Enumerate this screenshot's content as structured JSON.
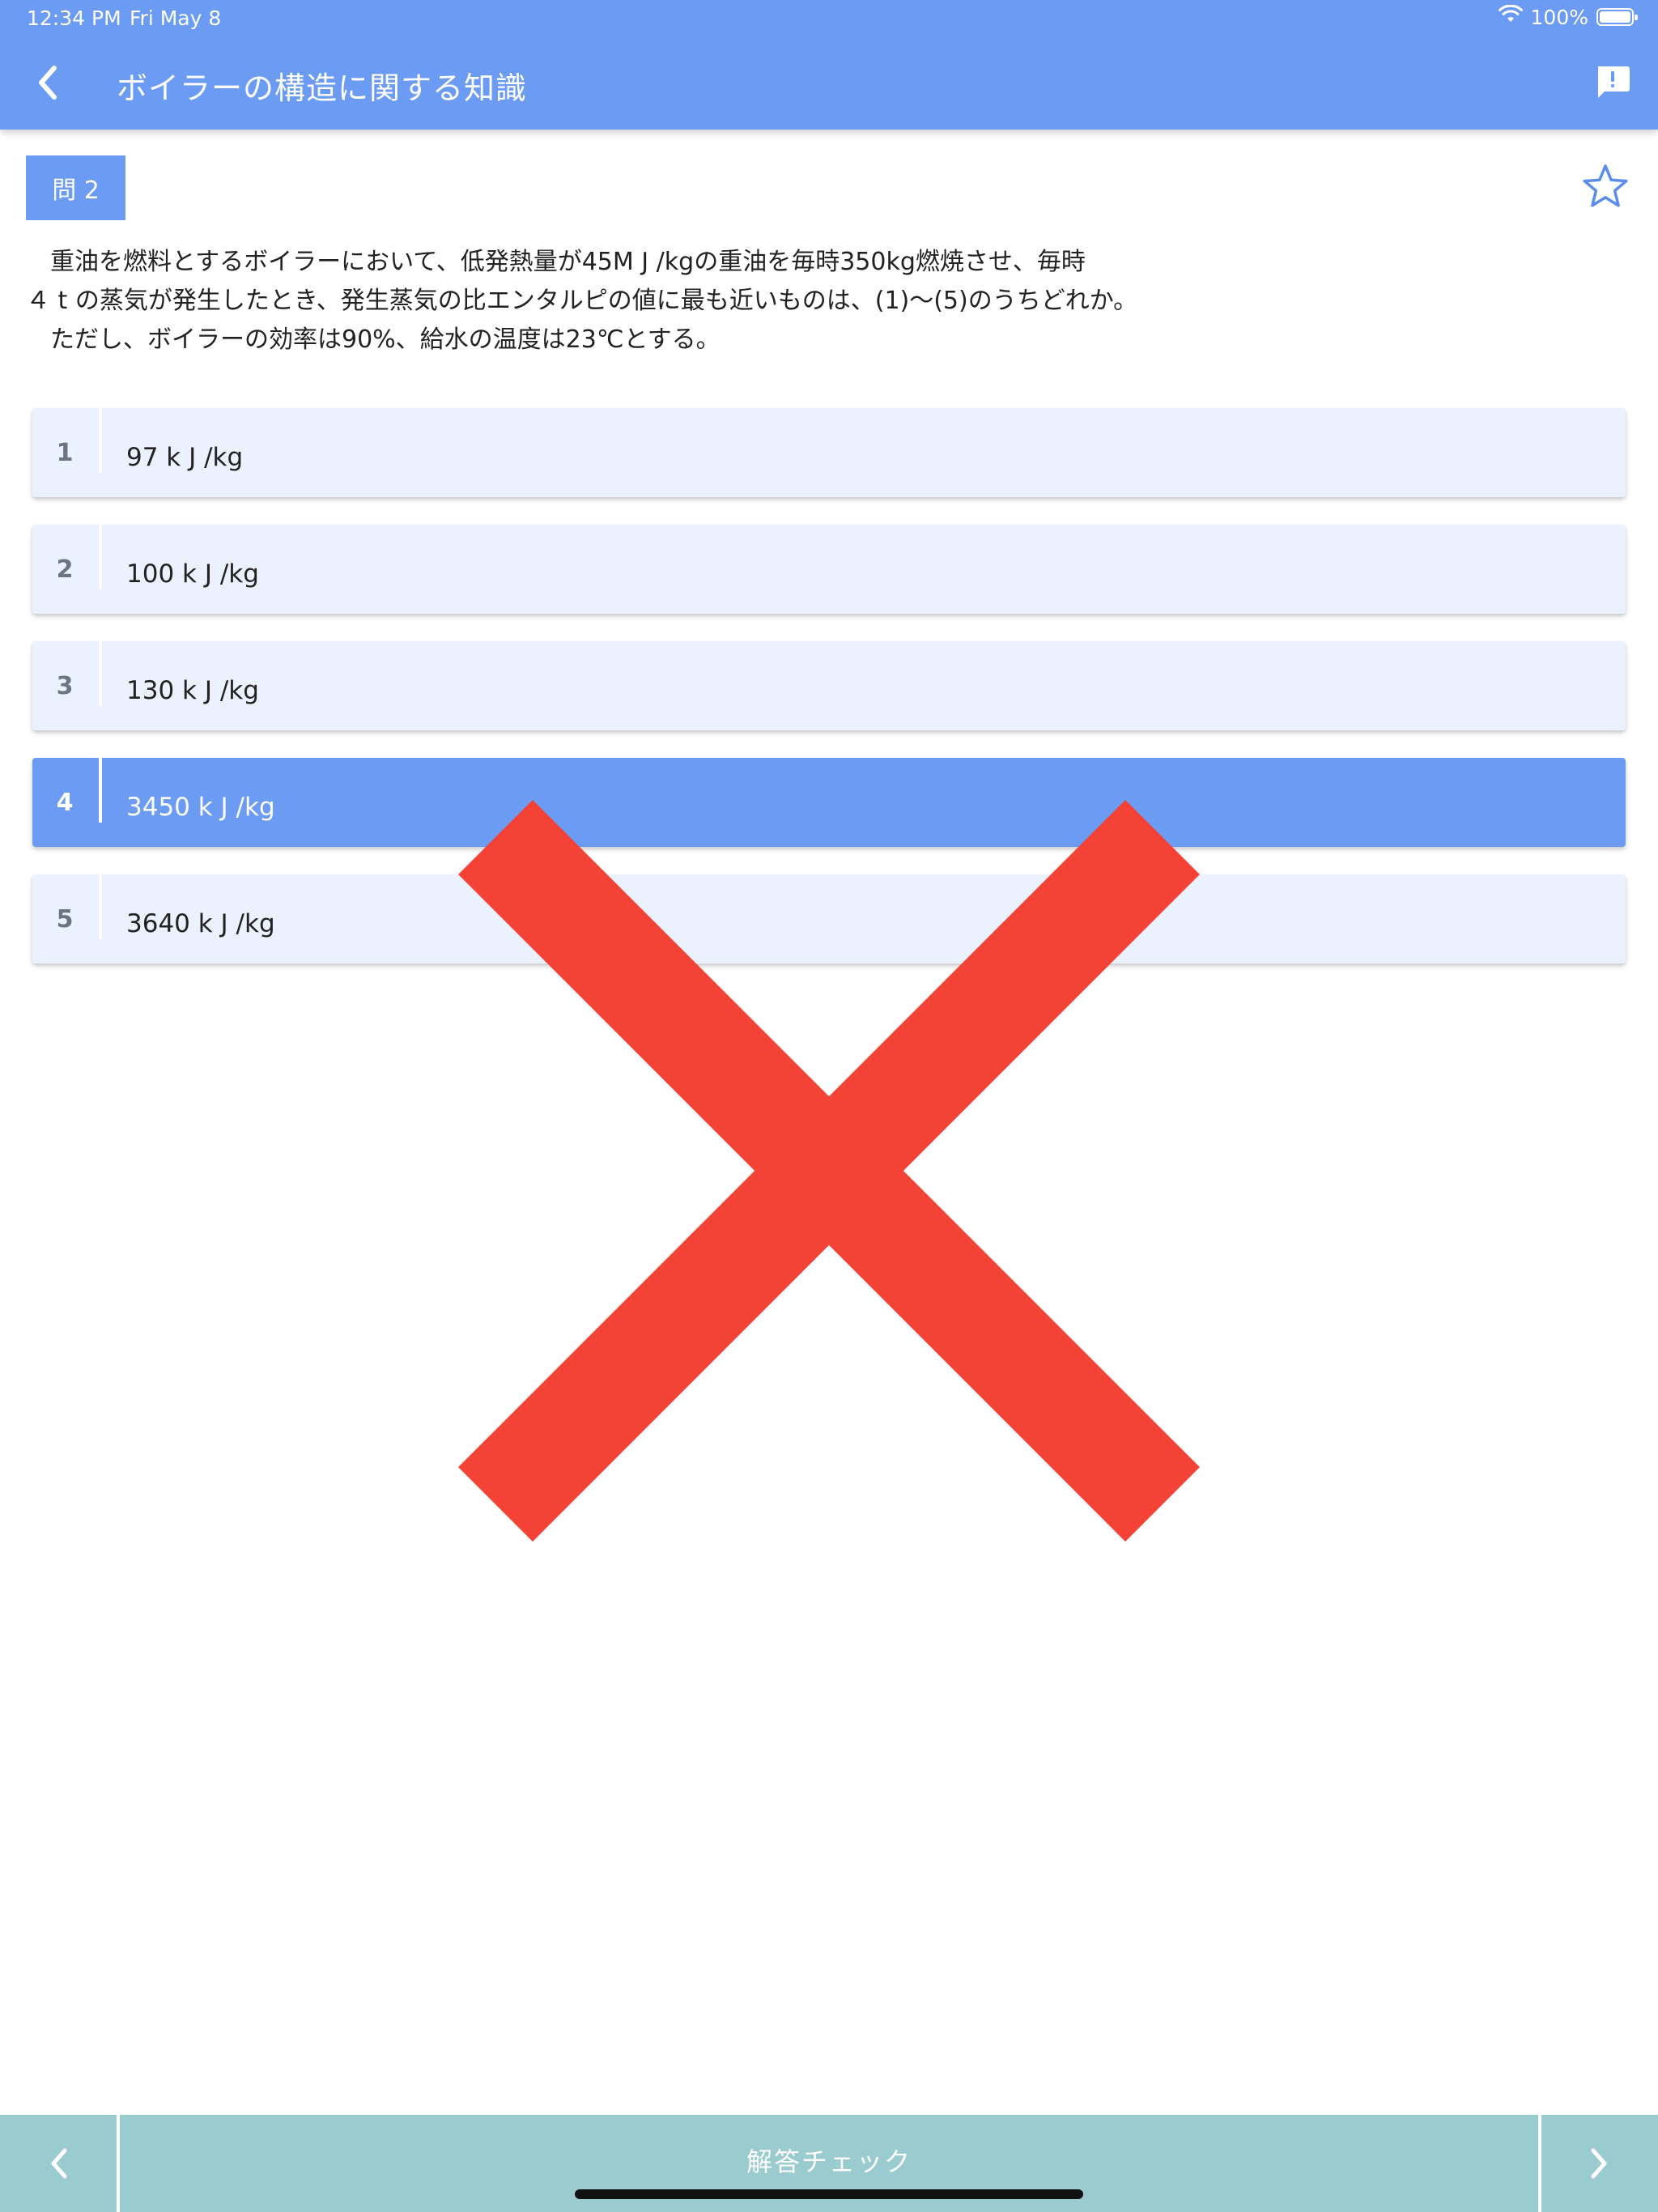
{
  "status_bar": {
    "time": "12:34 PM",
    "date": "Fri May 8",
    "battery": "100%"
  },
  "header": {
    "title": "ボイラーの構造に関する知識"
  },
  "question": {
    "badge": "問 2",
    "lines": [
      "　重油を燃料とするボイラーにおいて、低発熱量が45M J /kgの重油を毎時350kg燃焼させ、毎時",
      "４ t の蒸気が発生したとき、発生蒸気の比エンタルピの値に最も近いものは、(1)〜(5)のうちどれか。",
      "　ただし、ボイラーの効率は90%、給水の温度は23℃とする。"
    ]
  },
  "choices": [
    {
      "num": "1",
      "label": "97 k J /kg"
    },
    {
      "num": "2",
      "label": "100 k J /kg"
    },
    {
      "num": "3",
      "label": "130 k J /kg"
    },
    {
      "num": "4",
      "label": "3450 k J /kg"
    },
    {
      "num": "5",
      "label": "3640 k J /kg"
    }
  ],
  "selected_choice": 4,
  "result": "wrong",
  "footer": {
    "check_label": "解答チェック"
  },
  "colors": {
    "accent": "#6b9bf2",
    "choice_bg": "#ebf1fe",
    "footer": "#9acbce",
    "wrong_mark": "#f44336"
  }
}
